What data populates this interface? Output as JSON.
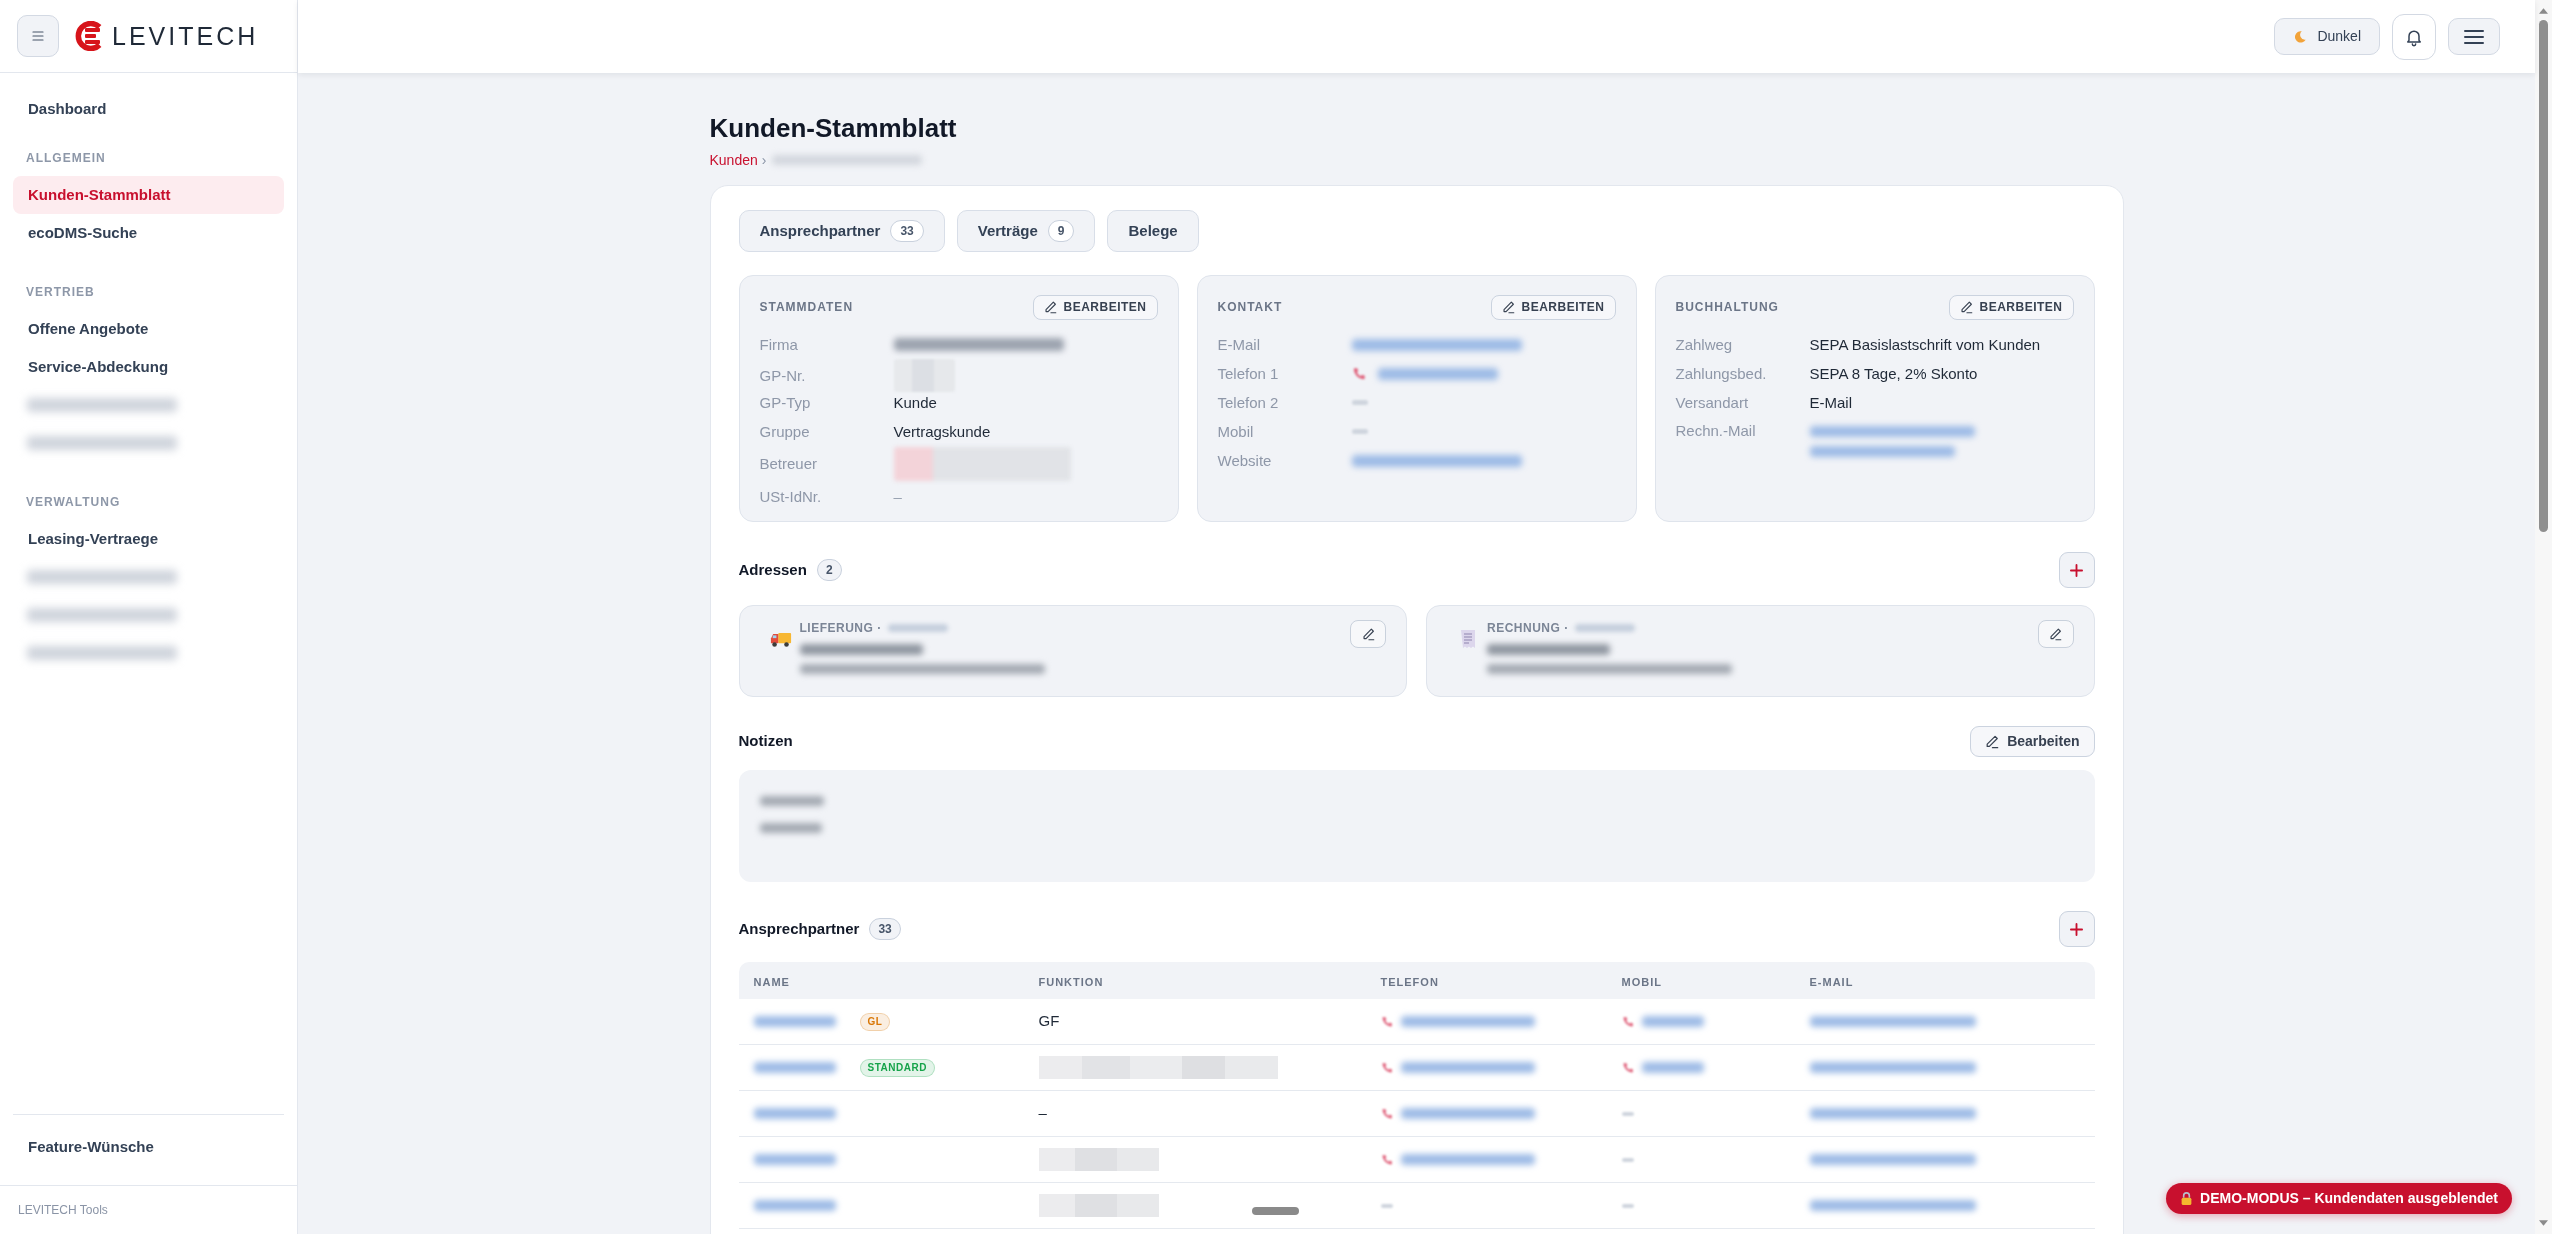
{
  "sidebar": {
    "logo": "LEVITECH",
    "nav": [
      {
        "kind": "link",
        "label": "Dashboard",
        "selected": false
      }
    ],
    "sections": [
      {
        "heading": "ALLGEMEIN",
        "items": [
          {
            "kind": "link",
            "label": "Kunden-Stammblatt",
            "selected": true
          },
          {
            "kind": "link",
            "label": "ecoDMS-Suche",
            "selected": false
          }
        ]
      },
      {
        "heading": "VERTRIEB",
        "items": [
          {
            "kind": "link",
            "label": "Offene Angebote",
            "selected": false
          },
          {
            "kind": "link",
            "label": "Service-Abdeckung",
            "selected": false
          },
          {
            "kind": "redacted",
            "selected": false
          },
          {
            "kind": "redacted",
            "selected": false
          }
        ]
      },
      {
        "heading": "VERWALTUNG",
        "items": [
          {
            "kind": "link",
            "label": "Leasing-Vertraege",
            "selected": false
          },
          {
            "kind": "redacted",
            "selected": false
          },
          {
            "kind": "redacted",
            "selected": false
          },
          {
            "kind": "redacted",
            "selected": false
          }
        ]
      }
    ],
    "bottom": [
      {
        "kind": "link",
        "label": "Feature-Wünsche",
        "selected": false
      }
    ],
    "footer": "LEVITECH Tools"
  },
  "header": {
    "theme_button": "Dunkel"
  },
  "page": {
    "title": "Kunden-Stammblatt",
    "breadcrumb": {
      "parent": "Kunden",
      "separator": "›"
    }
  },
  "jump_buttons": [
    {
      "label": "Ansprechpartner",
      "count": "33"
    },
    {
      "label": "Verträge",
      "count": "9"
    },
    {
      "label": "Belege"
    }
  ],
  "info_cards": [
    {
      "title": "STAMMDATEN",
      "edit_label": "BEARBEITEN",
      "rows": [
        {
          "label": "Firma",
          "kind": "redacted"
        },
        {
          "label": "GP-Nr.",
          "kind": "pixelated"
        },
        {
          "label": "GP-Typ",
          "kind": "text",
          "value": "Kunde"
        },
        {
          "label": "Gruppe",
          "kind": "text",
          "value": "Vertragskunde"
        },
        {
          "label": "Betreuer",
          "kind": "redacted_person"
        },
        {
          "label": "USt-IdNr.",
          "kind": "muted",
          "value": "–"
        }
      ]
    },
    {
      "title": "KONTAKT",
      "edit_label": "BEARBEITEN",
      "rows": [
        {
          "label": "E-Mail",
          "kind": "redacted_link"
        },
        {
          "label": "Telefon 1",
          "kind": "redacted_phone"
        },
        {
          "label": "Telefon 2",
          "kind": "redacted_faint"
        },
        {
          "label": "Mobil",
          "kind": "redacted_faint"
        },
        {
          "label": "Website",
          "kind": "redacted_link"
        }
      ]
    },
    {
      "title": "BUCHHALTUNG",
      "edit_label": "BEARBEITEN",
      "rows": [
        {
          "label": "Zahlweg",
          "kind": "text",
          "value": "SEPA Basislastschrift vom Kunden"
        },
        {
          "label": "Zahlungsbed.",
          "kind": "text",
          "value": "SEPA 8 Tage, 2% Skonto"
        },
        {
          "label": "Versandart",
          "kind": "text",
          "value": "E-Mail"
        },
        {
          "label": "Rechn.-Mail",
          "kind": "redacted_links"
        }
      ]
    }
  ],
  "addresses": {
    "title": "Adressen",
    "count": "2",
    "items": [
      {
        "kind": "delivery",
        "label": "LIEFERUNG ·"
      },
      {
        "kind": "invoice",
        "label": "RECHNUNG ·"
      }
    ]
  },
  "notes": {
    "title": "Notizen",
    "edit_label": "Bearbeiten"
  },
  "contacts": {
    "title": "Ansprechpartner",
    "count": "33",
    "columns": [
      "NAME",
      "FUNKTION",
      "TELEFON",
      "MOBIL",
      "E-MAIL"
    ],
    "rows": [
      {
        "tag": {
          "label": "GL",
          "color": "#d97706"
        },
        "function": {
          "kind": "text",
          "value": "GF"
        },
        "phone": {
          "kind": "redacted_phone"
        },
        "mobile": {
          "kind": "redacted_phone"
        }
      },
      {
        "tag": {
          "label": "STANDARD",
          "color": "#16a34a"
        },
        "function": {
          "kind": "redacted_long"
        },
        "phone": {
          "kind": "redacted_phone"
        },
        "mobile": {
          "kind": "redacted_phone"
        }
      },
      {
        "function": {
          "kind": "text",
          "value": "–"
        },
        "phone": {
          "kind": "redacted_phone"
        },
        "mobile": {
          "kind": "redacted_faint"
        }
      },
      {
        "function": {
          "kind": "redacted_short"
        },
        "phone": {
          "kind": "redacted_phone"
        },
        "mobile": {
          "kind": "redacted_faint"
        }
      },
      {
        "function": {
          "kind": "redacted_short"
        },
        "phone": {
          "kind": "redacted_faint"
        },
        "mobile": {
          "kind": "redacted_faint"
        }
      }
    ]
  },
  "demo_banner": "DEMO-MODUS – Kundendaten ausgeblendet"
}
